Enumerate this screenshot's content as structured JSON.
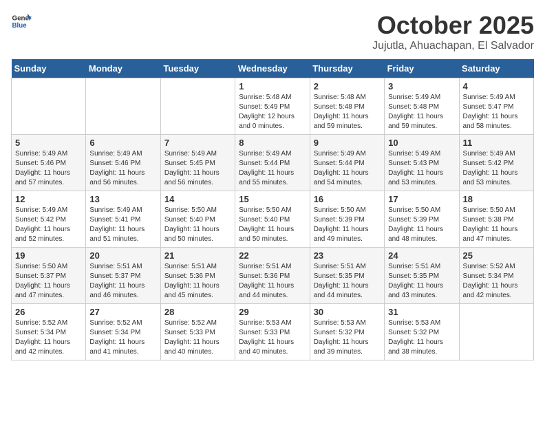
{
  "header": {
    "logo": {
      "general": "General",
      "blue": "Blue"
    },
    "month": "October 2025",
    "location": "Jujutla, Ahuachapan, El Salvador"
  },
  "days_of_week": [
    "Sunday",
    "Monday",
    "Tuesday",
    "Wednesday",
    "Thursday",
    "Friday",
    "Saturday"
  ],
  "weeks": [
    [
      {
        "day": "",
        "info": ""
      },
      {
        "day": "",
        "info": ""
      },
      {
        "day": "",
        "info": ""
      },
      {
        "day": "1",
        "info": "Sunrise: 5:48 AM\nSunset: 5:49 PM\nDaylight: 12 hours\nand 0 minutes."
      },
      {
        "day": "2",
        "info": "Sunrise: 5:48 AM\nSunset: 5:48 PM\nDaylight: 11 hours\nand 59 minutes."
      },
      {
        "day": "3",
        "info": "Sunrise: 5:49 AM\nSunset: 5:48 PM\nDaylight: 11 hours\nand 59 minutes."
      },
      {
        "day": "4",
        "info": "Sunrise: 5:49 AM\nSunset: 5:47 PM\nDaylight: 11 hours\nand 58 minutes."
      }
    ],
    [
      {
        "day": "5",
        "info": "Sunrise: 5:49 AM\nSunset: 5:46 PM\nDaylight: 11 hours\nand 57 minutes."
      },
      {
        "day": "6",
        "info": "Sunrise: 5:49 AM\nSunset: 5:46 PM\nDaylight: 11 hours\nand 56 minutes."
      },
      {
        "day": "7",
        "info": "Sunrise: 5:49 AM\nSunset: 5:45 PM\nDaylight: 11 hours\nand 56 minutes."
      },
      {
        "day": "8",
        "info": "Sunrise: 5:49 AM\nSunset: 5:44 PM\nDaylight: 11 hours\nand 55 minutes."
      },
      {
        "day": "9",
        "info": "Sunrise: 5:49 AM\nSunset: 5:44 PM\nDaylight: 11 hours\nand 54 minutes."
      },
      {
        "day": "10",
        "info": "Sunrise: 5:49 AM\nSunset: 5:43 PM\nDaylight: 11 hours\nand 53 minutes."
      },
      {
        "day": "11",
        "info": "Sunrise: 5:49 AM\nSunset: 5:42 PM\nDaylight: 11 hours\nand 53 minutes."
      }
    ],
    [
      {
        "day": "12",
        "info": "Sunrise: 5:49 AM\nSunset: 5:42 PM\nDaylight: 11 hours\nand 52 minutes."
      },
      {
        "day": "13",
        "info": "Sunrise: 5:49 AM\nSunset: 5:41 PM\nDaylight: 11 hours\nand 51 minutes."
      },
      {
        "day": "14",
        "info": "Sunrise: 5:50 AM\nSunset: 5:40 PM\nDaylight: 11 hours\nand 50 minutes."
      },
      {
        "day": "15",
        "info": "Sunrise: 5:50 AM\nSunset: 5:40 PM\nDaylight: 11 hours\nand 50 minutes."
      },
      {
        "day": "16",
        "info": "Sunrise: 5:50 AM\nSunset: 5:39 PM\nDaylight: 11 hours\nand 49 minutes."
      },
      {
        "day": "17",
        "info": "Sunrise: 5:50 AM\nSunset: 5:39 PM\nDaylight: 11 hours\nand 48 minutes."
      },
      {
        "day": "18",
        "info": "Sunrise: 5:50 AM\nSunset: 5:38 PM\nDaylight: 11 hours\nand 47 minutes."
      }
    ],
    [
      {
        "day": "19",
        "info": "Sunrise: 5:50 AM\nSunset: 5:37 PM\nDaylight: 11 hours\nand 47 minutes."
      },
      {
        "day": "20",
        "info": "Sunrise: 5:51 AM\nSunset: 5:37 PM\nDaylight: 11 hours\nand 46 minutes."
      },
      {
        "day": "21",
        "info": "Sunrise: 5:51 AM\nSunset: 5:36 PM\nDaylight: 11 hours\nand 45 minutes."
      },
      {
        "day": "22",
        "info": "Sunrise: 5:51 AM\nSunset: 5:36 PM\nDaylight: 11 hours\nand 44 minutes."
      },
      {
        "day": "23",
        "info": "Sunrise: 5:51 AM\nSunset: 5:35 PM\nDaylight: 11 hours\nand 44 minutes."
      },
      {
        "day": "24",
        "info": "Sunrise: 5:51 AM\nSunset: 5:35 PM\nDaylight: 11 hours\nand 43 minutes."
      },
      {
        "day": "25",
        "info": "Sunrise: 5:52 AM\nSunset: 5:34 PM\nDaylight: 11 hours\nand 42 minutes."
      }
    ],
    [
      {
        "day": "26",
        "info": "Sunrise: 5:52 AM\nSunset: 5:34 PM\nDaylight: 11 hours\nand 42 minutes."
      },
      {
        "day": "27",
        "info": "Sunrise: 5:52 AM\nSunset: 5:34 PM\nDaylight: 11 hours\nand 41 minutes."
      },
      {
        "day": "28",
        "info": "Sunrise: 5:52 AM\nSunset: 5:33 PM\nDaylight: 11 hours\nand 40 minutes."
      },
      {
        "day": "29",
        "info": "Sunrise: 5:53 AM\nSunset: 5:33 PM\nDaylight: 11 hours\nand 40 minutes."
      },
      {
        "day": "30",
        "info": "Sunrise: 5:53 AM\nSunset: 5:32 PM\nDaylight: 11 hours\nand 39 minutes."
      },
      {
        "day": "31",
        "info": "Sunrise: 5:53 AM\nSunset: 5:32 PM\nDaylight: 11 hours\nand 38 minutes."
      },
      {
        "day": "",
        "info": ""
      }
    ]
  ]
}
